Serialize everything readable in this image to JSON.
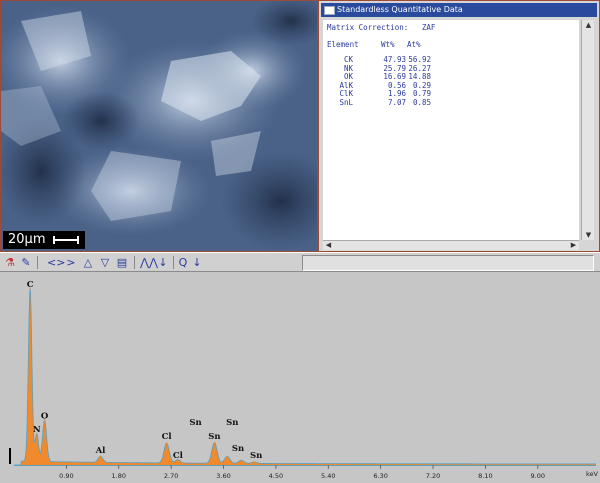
{
  "sem_image": {
    "scale_label": "20µm"
  },
  "quant_window": {
    "title": "Standardless Quantitative Data",
    "matrix_label": "Matrix Correction:",
    "matrix_value": "ZAF",
    "headers": [
      "Element",
      "Wt%",
      "At%"
    ],
    "rows": [
      {
        "element": "CK",
        "wt": "47.93",
        "at": "56.92"
      },
      {
        "element": "NK",
        "wt": "25.79",
        "at": "26.27"
      },
      {
        "element": "OK",
        "wt": "16.69",
        "at": "14.88"
      },
      {
        "element": "AlK",
        "wt": "0.56",
        "at": "0.29"
      },
      {
        "element": "ClK",
        "wt": "1.96",
        "at": "0.79"
      },
      {
        "element": "SnL",
        "wt": "7.07",
        "at": "0.85"
      }
    ]
  },
  "toolbar": {
    "icons": [
      "flask-icon",
      "edit-icon",
      "expand-horizontal-icon",
      "compress-horizontal-icon",
      "expand-vertical-icon",
      "compress-vertical-icon",
      "stack-icon",
      "peaks-icon",
      "arrow-down-icon",
      "zoom-icon",
      "arrow-down-icon"
    ]
  },
  "colors": {
    "spectrum_fill": "#f08a2c",
    "spectrum_line": "#5a9fc0",
    "title_bar": "#2a4a9e",
    "data_text": "#2a3a9e"
  },
  "chart_data": {
    "type": "area",
    "xlabel": "keV",
    "xlim": [
      0,
      10.0
    ],
    "ylim": [
      0,
      1
    ],
    "x_ticks": [
      "0.90",
      "1.80",
      "2.70",
      "3.60",
      "4.50",
      "5.40",
      "6.30",
      "7.20",
      "8.10",
      "9.00"
    ],
    "x_tick_values": [
      0.9,
      1.8,
      2.7,
      3.6,
      4.5,
      5.4,
      6.3,
      7.2,
      8.1,
      9.0
    ],
    "peaks": [
      {
        "label": "C",
        "energy": 0.277,
        "height": 1.0,
        "width": 0.03
      },
      {
        "label": "N",
        "energy": 0.392,
        "height": 0.16,
        "width": 0.03
      },
      {
        "label": "O",
        "energy": 0.525,
        "height": 0.24,
        "width": 0.035
      },
      {
        "label": "Al",
        "energy": 1.486,
        "height": 0.035,
        "width": 0.04
      },
      {
        "label": "Cl",
        "energy": 2.622,
        "height": 0.115,
        "width": 0.045
      },
      {
        "label": "Cl",
        "energy": 2.816,
        "height": 0.02,
        "width": 0.04
      },
      {
        "label": "Sn",
        "energy": 3.444,
        "height": 0.12,
        "width": 0.045
      },
      {
        "label": "Sn",
        "energy": 3.663,
        "height": 0.04,
        "width": 0.045
      },
      {
        "label": "Sn",
        "energy": 3.905,
        "height": 0.018,
        "width": 0.045
      },
      {
        "label": "Sn",
        "energy": 4.131,
        "height": 0.008,
        "width": 0.045
      }
    ],
    "peak_labels": [
      {
        "text": "C",
        "energy": 0.277,
        "height": 1.03
      },
      {
        "text": "N",
        "energy": 0.392,
        "height": 0.19
      },
      {
        "text": "O",
        "energy": 0.525,
        "height": 0.27
      },
      {
        "text": "Al",
        "energy": 1.486,
        "height": 0.07
      },
      {
        "text": "Cl",
        "energy": 2.622,
        "height": 0.15
      },
      {
        "text": "Cl",
        "energy": 2.816,
        "height": 0.04
      },
      {
        "text": "Sn",
        "energy": 3.12,
        "height": 0.23
      },
      {
        "text": "Sn",
        "energy": 3.444,
        "height": 0.15
      },
      {
        "text": "Sn",
        "energy": 3.75,
        "height": 0.23
      },
      {
        "text": "Sn",
        "energy": 3.85,
        "height": 0.08
      },
      {
        "text": "Sn",
        "energy": 4.16,
        "height": 0.04
      }
    ]
  }
}
